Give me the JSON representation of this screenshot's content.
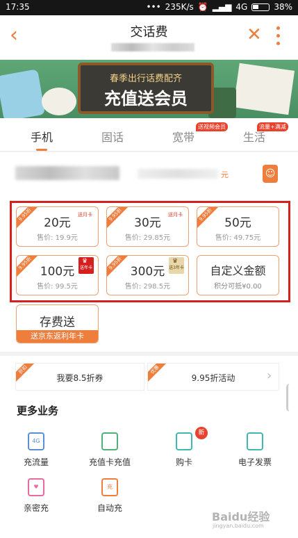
{
  "status_bar": {
    "time": "17:35",
    "net_speed": "235K/s",
    "network": "4G",
    "battery": "38%"
  },
  "header": {
    "title": "交话费",
    "back_icon": "chevron-left-icon",
    "close_icon": "close-icon",
    "more_icon": "more-vertical-icon",
    "accent_color": "#ef7d3c"
  },
  "banner": {
    "line1": "春季出行话费配齐",
    "line2": "充值送会员"
  },
  "tabs": [
    {
      "label": "手机",
      "active": true
    },
    {
      "label": "固话",
      "active": false
    },
    {
      "label": "宽带",
      "badge": "送视频会员",
      "active": false
    },
    {
      "label": "生活",
      "badge": "流量+满减",
      "active": false
    }
  ],
  "phone_row": {
    "suffix": "元",
    "contact_icon": "contact-book-icon"
  },
  "recharge_options": [
    {
      "amount": "20元",
      "price": "售价: 19.9元",
      "discount": "9.95折",
      "tag": "送月卡"
    },
    {
      "amount": "30元",
      "price": "售价: 29.85元",
      "discount": "9.95折",
      "tag": "送月卡"
    },
    {
      "amount": "50元",
      "price": "售价: 49.75元",
      "discount": "9.95折",
      "tag": ""
    },
    {
      "amount": "100元",
      "price": "售价: 99.5元",
      "discount": "9.95折",
      "tag": "送年卡"
    },
    {
      "amount": "300元",
      "price": "售价: 298.5元",
      "discount": "9.95折",
      "tag": "送3年卡"
    }
  ],
  "custom_amount": {
    "label": "自定义金额",
    "note": "积分可抵¥0.00"
  },
  "deposit": {
    "title": "存费送",
    "subtitle": "送京东返利年卡"
  },
  "promos": [
    {
      "ribbon": "折扣",
      "label": "我要8.5折券"
    },
    {
      "ribbon": "优惠",
      "label": "9.95折活动"
    }
  ],
  "more_services": {
    "title": "更多业务",
    "items": [
      {
        "label": "充流量",
        "icon": "data-4g-icon",
        "icon_text": "4G",
        "color": "#5a8fd8"
      },
      {
        "label": "充值卡充值",
        "icon": "card-icon",
        "icon_text": "",
        "color": "#4fb07a"
      },
      {
        "label": "购卡",
        "icon": "sim-cart-icon",
        "icon_text": "",
        "color": "#3fb8b0",
        "badge": "新"
      },
      {
        "label": "电子发票",
        "icon": "invoice-icon",
        "icon_text": "",
        "color": "#3fb8b0"
      },
      {
        "label": "亲密充",
        "icon": "heart-phone-icon",
        "icon_text": "♥",
        "color": "#e86aa0"
      },
      {
        "label": "自动充",
        "icon": "auto-recharge-icon",
        "icon_text": "充",
        "color": "#ef7d3c"
      }
    ]
  },
  "watermark": {
    "main": "Baidu经验",
    "sub": "jingyan.baidu.com"
  }
}
